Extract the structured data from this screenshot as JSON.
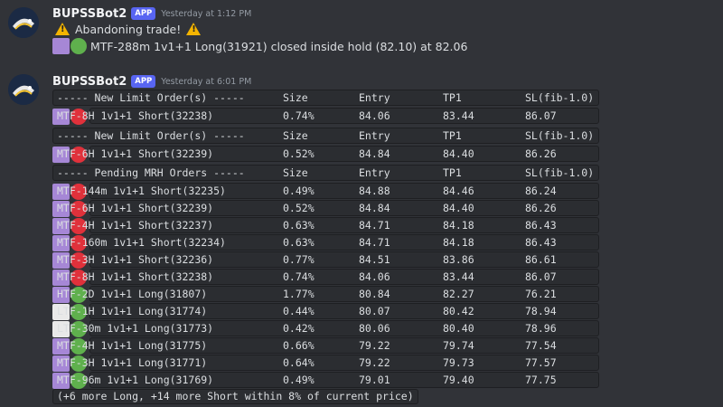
{
  "colors": {
    "purple": "#a687d6",
    "white": "#e9e9e9",
    "green": "#5fb04d",
    "red": "#e0313b",
    "code_bg": "#2b2d31",
    "bg": "#313338"
  },
  "msg1": {
    "username": "BUPSSBot2",
    "badge": "APP",
    "timestamp": "Yesterday at 1:12 PM",
    "line1": "Abandoning trade!",
    "line2": "MTF-288m 1v1+1 Long(31921) closed inside hold (82.10) at 82.06",
    "line2_square": "purple",
    "line2_dot": "green"
  },
  "msg2": {
    "username": "BUPSSBot2",
    "badge": "APP",
    "timestamp": "Yesterday at 6:01 PM",
    "rows": [
      {
        "sq": null,
        "dot": null,
        "cells": [
          "----- New Limit Order(s) -----",
          "Size",
          "Entry",
          "TP1",
          "SL(fib-1.0)"
        ]
      },
      {
        "sq": "purple",
        "dot": "red",
        "cells": [
          "MTF-8H 1v1+1 Short(32238)",
          "0.74%",
          "84.06",
          "83.44",
          "86.07"
        ]
      },
      {
        "sq": null,
        "dot": null,
        "cells": [
          "----- New Limit Order(s) -----",
          "Size",
          "Entry",
          "TP1",
          "SL(fib-1.0)"
        ]
      },
      {
        "sq": "purple",
        "dot": "red",
        "cells": [
          "MTF-6H 1v1+1 Short(32239)",
          "0.52%",
          "84.84",
          "84.40",
          "86.26"
        ]
      },
      {
        "sq": null,
        "dot": null,
        "cells": [
          "----- Pending MRH Orders -----",
          "Size",
          "Entry",
          "TP1",
          "SL(fib-1.0)"
        ]
      },
      {
        "sq": "purple",
        "dot": "red",
        "cells": [
          "MTF-144m 1v1+1 Short(32235)",
          "0.49%",
          "84.88",
          "84.46",
          "86.24"
        ]
      },
      {
        "sq": "purple",
        "dot": "red",
        "cells": [
          "MTF-6H 1v1+1 Short(32239)",
          "0.52%",
          "84.84",
          "84.40",
          "86.26"
        ]
      },
      {
        "sq": "purple",
        "dot": "red",
        "cells": [
          "MTF-4H 1v1+1 Short(32237)",
          "0.63%",
          "84.71",
          "84.18",
          "86.43"
        ]
      },
      {
        "sq": "purple",
        "dot": "red",
        "cells": [
          "MTF-160m 1v1+1 Short(32234)",
          "0.63%",
          "84.71",
          "84.18",
          "86.43"
        ]
      },
      {
        "sq": "purple",
        "dot": "red",
        "cells": [
          "MTF-3H 1v1+1 Short(32236)",
          "0.77%",
          "84.51",
          "83.86",
          "86.61"
        ]
      },
      {
        "sq": "purple",
        "dot": "red",
        "cells": [
          "MTF-8H 1v1+1 Short(32238)",
          "0.74%",
          "84.06",
          "83.44",
          "86.07"
        ]
      },
      {
        "sq": "purple",
        "dot": "green",
        "cells": [
          "HTF-2D 1v1+1 Long(31807)",
          "1.77%",
          "80.84",
          "82.27",
          "76.21"
        ]
      },
      {
        "sq": "white",
        "dot": "green",
        "cells": [
          "LTF-1H 1v1+1 Long(31774)",
          "0.44%",
          "80.07",
          "80.42",
          "78.94"
        ]
      },
      {
        "sq": "white",
        "dot": "green",
        "cells": [
          "LTF-30m 1v1+1 Long(31773)",
          "0.42%",
          "80.06",
          "80.40",
          "78.96"
        ]
      },
      {
        "sq": "purple",
        "dot": "green",
        "cells": [
          "MTF-4H 1v1+1 Long(31775)",
          "0.66%",
          "79.22",
          "79.74",
          "77.54"
        ]
      },
      {
        "sq": "purple",
        "dot": "green",
        "cells": [
          "MTF-3H 1v1+1 Long(31771)",
          "0.64%",
          "79.22",
          "79.73",
          "77.57"
        ]
      },
      {
        "sq": "purple",
        "dot": "green",
        "cells": [
          "MTF-96m 1v1+1 Long(31769)",
          "0.49%",
          "79.01",
          "79.40",
          "77.75"
        ]
      }
    ],
    "footer": "(+6 more Long, +14 more Short within 8% of current price)"
  }
}
